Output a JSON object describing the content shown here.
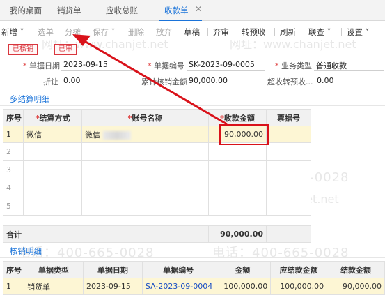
{
  "tabs": [
    {
      "label": "我的桌面"
    },
    {
      "label": "销货单"
    },
    {
      "label": "应收总账"
    },
    {
      "label": "收款单"
    }
  ],
  "toolbar": {
    "new": "新增",
    "select": "选单",
    "split": "分摊",
    "save": "保存",
    "delete": "删除",
    "abandon": "放弃",
    "draft": "草稿",
    "unaudit": "弃审",
    "to_prepay": "转预收",
    "refresh": "刷新",
    "link": "联查",
    "settings": "设置"
  },
  "badges": {
    "verified": "已核销",
    "audited": "已审"
  },
  "form": {
    "date_label": "单据日期",
    "date_value": "2023-09-15",
    "number_label": "单据编号",
    "number_value": "SK-2023-09-0005",
    "biz_type_label": "业务类型",
    "biz_type_value": "普通收款",
    "discount_label": "折让",
    "discount_value": "0.00",
    "verify_amount_label": "累计核销金额",
    "verify_amount_value": "90,000.00",
    "over_prepay_label": "超收转预收...",
    "over_prepay_value": "0.00"
  },
  "settlement": {
    "section_title": "多结算明细",
    "headers": [
      "序号",
      "结算方式",
      "账号名称",
      "收款金额",
      "票据号"
    ],
    "rows": [
      {
        "idx": "1",
        "method": "微信",
        "account": "微信",
        "amount": "90,000.00",
        "ticket": ""
      },
      {
        "idx": "2"
      },
      {
        "idx": "3"
      },
      {
        "idx": "4"
      },
      {
        "idx": "5"
      }
    ],
    "total_label": "合计",
    "total_value": "90,000.00"
  },
  "verify": {
    "section_title": "核销明细",
    "headers": [
      "序号",
      "单据类型",
      "单据日期",
      "单据编号",
      "金额",
      "应结款金额",
      "结款金额"
    ],
    "rows": [
      {
        "idx": "1",
        "type": "销货单",
        "date": "2023-09-15",
        "number": "SA-2023-09-0004",
        "amount": "100,000.00",
        "due": "100,000.00",
        "paid": "90,000.00"
      }
    ]
  },
  "watermark": {
    "phone": "电话：400-665-0028",
    "site": "网址：www.chanjet.net"
  },
  "colors": {
    "accent": "#1a73d9",
    "highlight": "#d9121a",
    "selected_row": "#fdf6d4"
  }
}
